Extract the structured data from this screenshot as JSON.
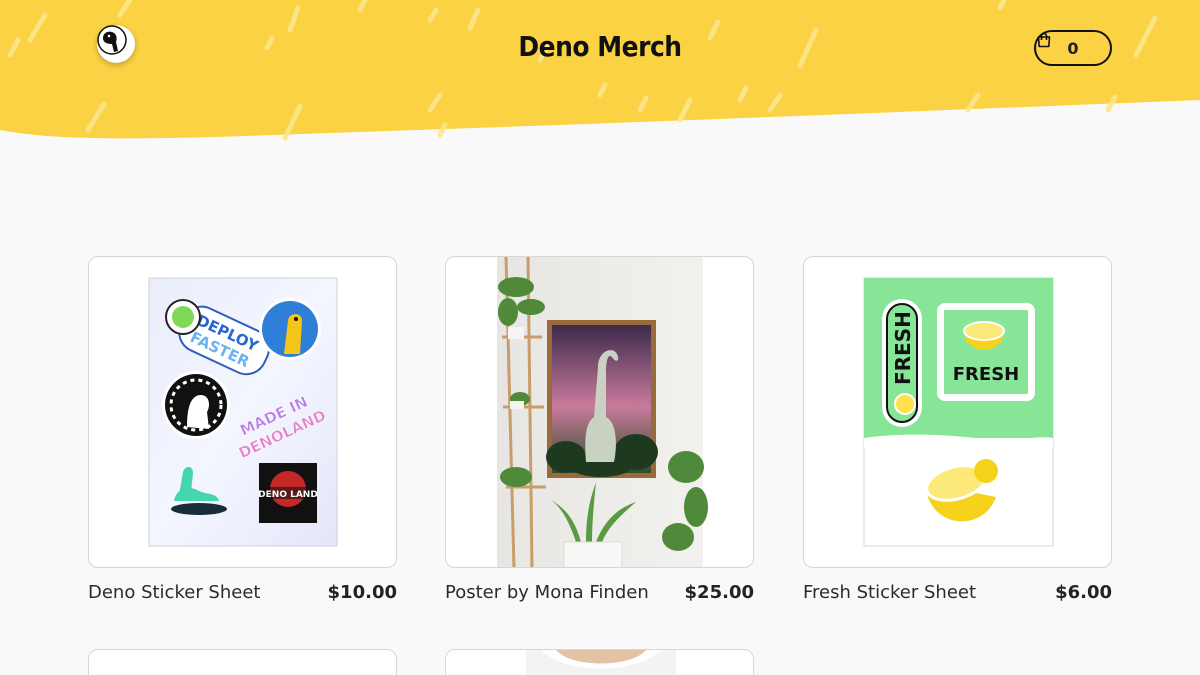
{
  "header": {
    "title": "Deno Merch",
    "cart_count": "0",
    "brand_color": "#fad244"
  },
  "products": [
    {
      "name": "Deno Sticker Sheet",
      "price": "$10.00",
      "image": "deno-sticker-sheet-image"
    },
    {
      "name": "Poster by Mona Finden",
      "price": "$25.00",
      "image": "dinosaur-poster-image"
    },
    {
      "name": "Fresh Sticker Sheet",
      "price": "$6.00",
      "image": "fresh-sticker-sheet-image"
    }
  ],
  "sticker_text": {
    "deploy": "DEPLOY",
    "faster": "FASTER",
    "made_in": "MADE IN",
    "denoland": "DENOLAND",
    "deno_land": "DENO LAND",
    "fresh": "FRESH"
  }
}
